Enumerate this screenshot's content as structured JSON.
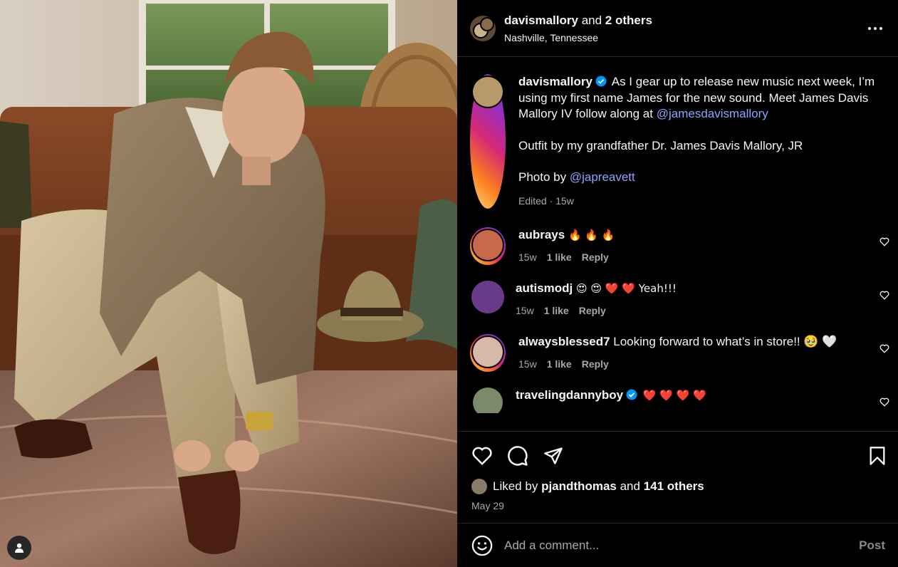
{
  "colors": {
    "background": "#000000",
    "mention": "#8ea3ff",
    "muted": "#a8a8a8",
    "verified": "#0095f6"
  },
  "header": {
    "username": "davismallory",
    "and_text": "and",
    "others": "2 others",
    "location": "Nashville, Tennessee"
  },
  "caption": {
    "username": "davismallory",
    "text_1": "As I gear up to release new music next week, I’m using my first name James for the new sound. Meet James Davis Mallory IV follow along at",
    "mention_1": "@jamesdavismallory",
    "text_2": "Outfit by my grandfather Dr. James Davis Mallory, JR",
    "text_3": "Photo by",
    "mention_2": "@japreavett",
    "meta": "Edited · 15w"
  },
  "comments": [
    {
      "username": "aubrays",
      "text": "🔥 🔥 🔥",
      "time": "15w",
      "likes": "1 like",
      "reply": "Reply"
    },
    {
      "username": "autismodj",
      "text": "😍 😍 ❤️ ❤️ Yeah!!!",
      "time": "15w",
      "likes": "1 like",
      "reply": "Reply"
    },
    {
      "username": "alwaysblessed7",
      "text": "Looking forward to what’s in store!! 🥹 🤍",
      "time": "15w",
      "likes": "1 like",
      "reply": "Reply"
    },
    {
      "username": "travelingdannyboy",
      "text": "❤️ ❤️ ❤️ ❤️"
    }
  ],
  "likes": {
    "prefix": "Liked by",
    "user": "pjandthomas",
    "and_text": "and",
    "others": "141 others"
  },
  "date": "May 29",
  "composer": {
    "placeholder": "Add a comment...",
    "post_label": "Post"
  },
  "icons": [
    "more-icon",
    "verified-icon",
    "heart-icon",
    "comment-icon",
    "share-icon",
    "bookmark-icon",
    "emoji-icon",
    "user-tag-icon"
  ]
}
